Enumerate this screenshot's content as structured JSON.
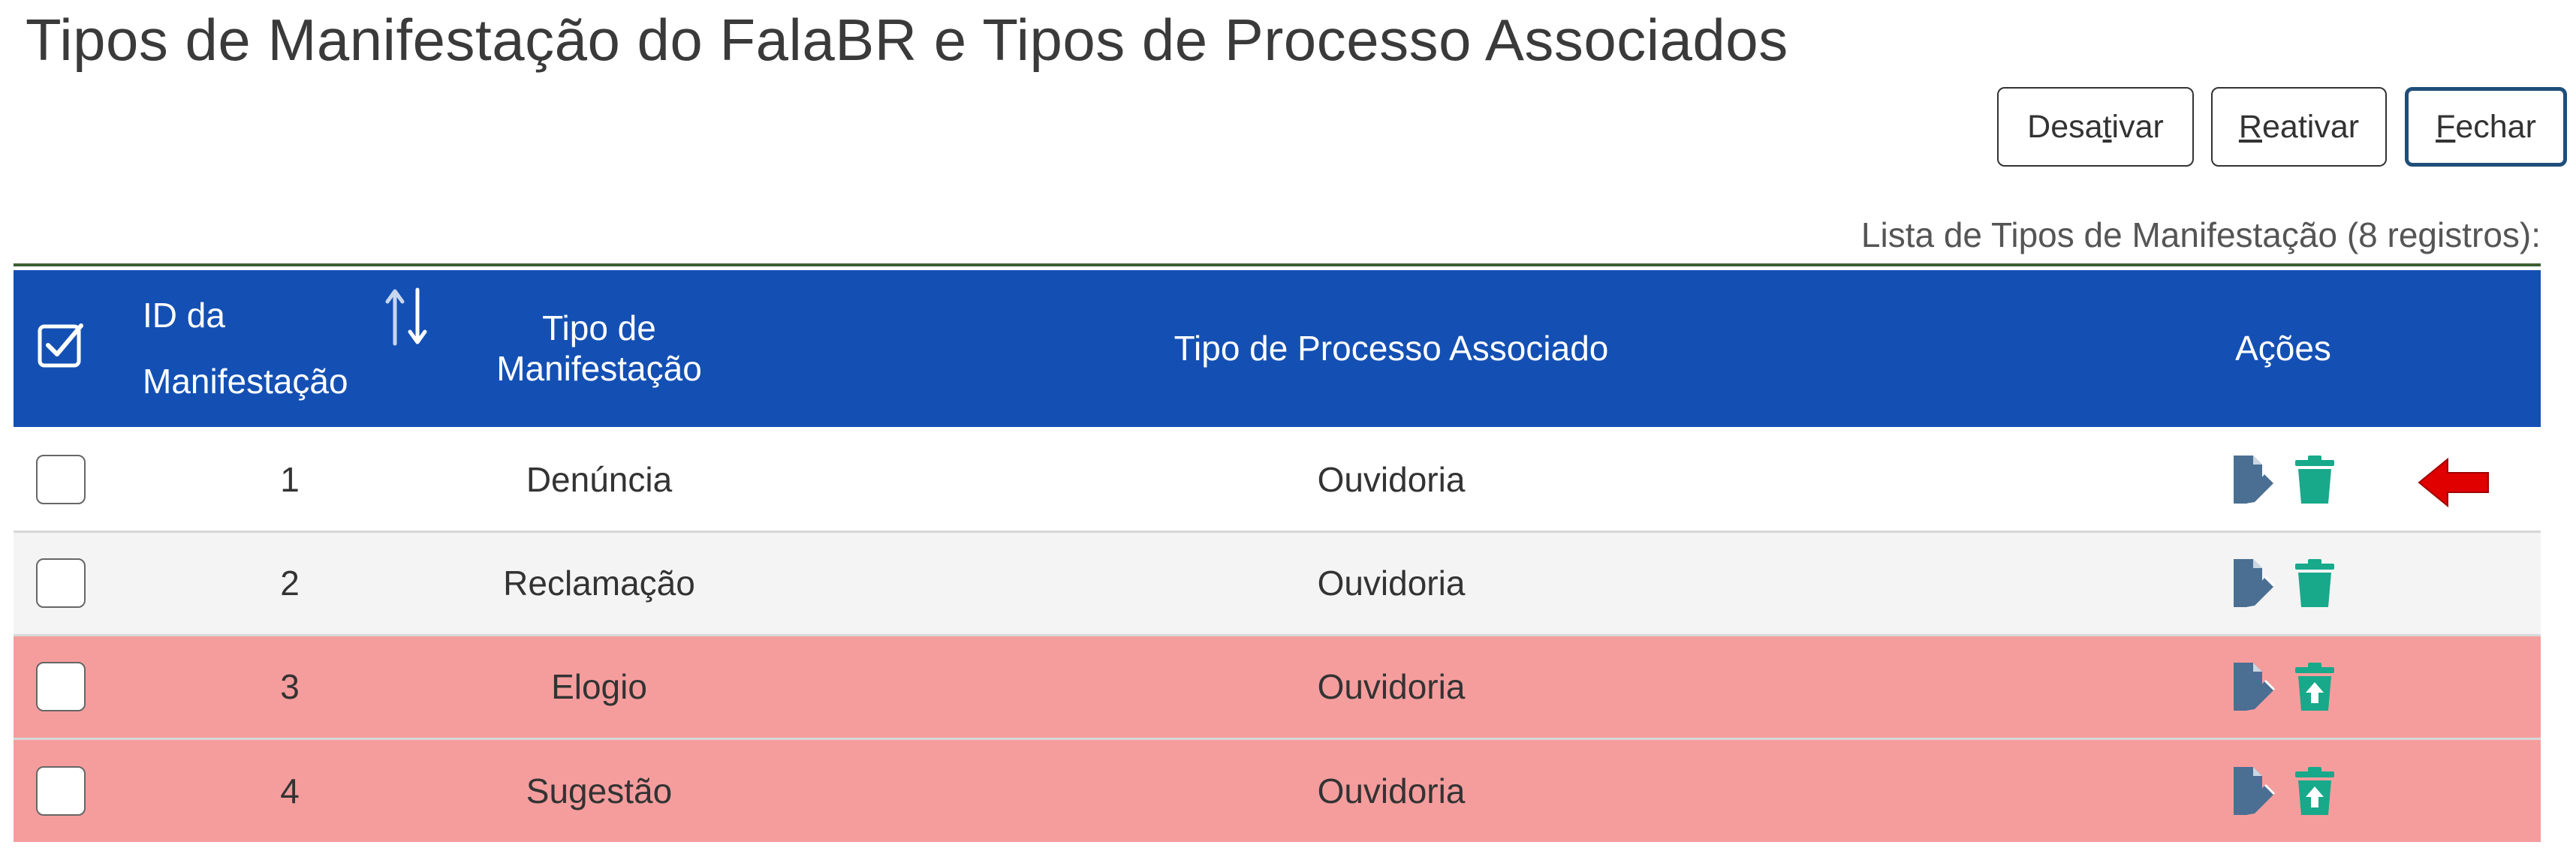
{
  "page": {
    "title": "Tipos de Manifestação do FalaBR e Tipos de Processo Associados"
  },
  "buttons": {
    "desativar": {
      "pre": "Desa",
      "key": "t",
      "post": "ivar"
    },
    "reativar": {
      "pre": "",
      "key": "R",
      "post": "eativar"
    },
    "fechar": {
      "pre": "",
      "key": "F",
      "post": "echar"
    }
  },
  "table": {
    "caption": "Lista de Tipos de Manifestação (8 registros):",
    "headers": {
      "id_line1": "ID da",
      "id_line2": "Manifestação",
      "tipo": "Tipo de Manifestação",
      "processo": "Tipo de Processo Associado",
      "acoes": "Ações"
    },
    "rows": [
      {
        "id": "1",
        "tipo": "Denúncia",
        "processo": "Ouvidoria",
        "status": "active"
      },
      {
        "id": "2",
        "tipo": "Reclamação",
        "processo": "Ouvidoria",
        "status": "active"
      },
      {
        "id": "3",
        "tipo": "Elogio",
        "processo": "Ouvidoria",
        "status": "inactive"
      },
      {
        "id": "4",
        "tipo": "Sugestão",
        "processo": "Ouvidoria",
        "status": "inactive"
      }
    ]
  },
  "colors": {
    "header_bg": "#1450b4",
    "inactive_row": "#f59d9d",
    "edit_icon": "#4a6f93",
    "action_icon": "#17a98a",
    "callout_arrow": "#e00000"
  },
  "icons": {
    "header_checkbox": "check-square-icon",
    "sort": "sort-icon",
    "edit": "edit-document-icon",
    "delete": "trash-icon",
    "reactivate": "trash-restore-icon",
    "callout": "red-arrow-left-icon"
  }
}
